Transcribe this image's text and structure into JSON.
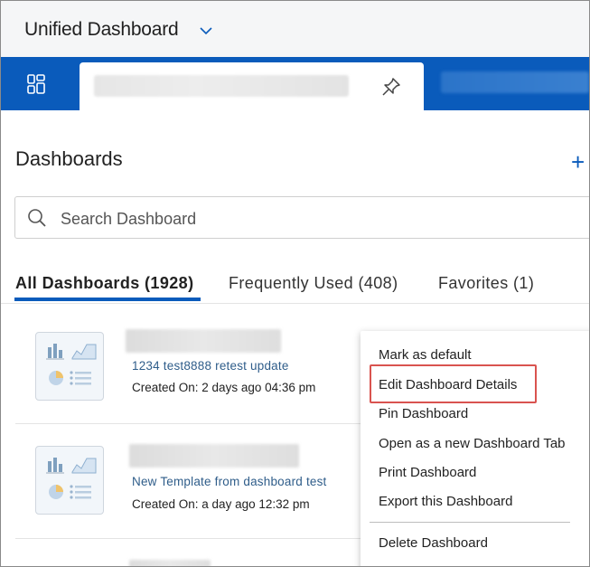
{
  "header": {
    "title": "Unified Dashboard"
  },
  "panel": {
    "title": "Dashboards",
    "add_label": "+",
    "search_placeholder": "Search Dashboard"
  },
  "tabs": [
    {
      "label": "All Dashboards (1928)"
    },
    {
      "label": "Frequently Used (408)"
    },
    {
      "label": "Favorites (1)"
    }
  ],
  "rows": [
    {
      "description": "1234 test8888 retest update",
      "created": "Created On: 2 days ago 04:36 pm"
    },
    {
      "description": "New Template from dashboard test",
      "created": "Created On: a day ago 12:32 pm"
    }
  ],
  "context_menu": {
    "items": [
      "Mark as default",
      "Edit Dashboard Details",
      "Pin Dashboard",
      "Open as a new Dashboard Tab",
      "Print Dashboard",
      "Export this Dashboard",
      "Delete Dashboard"
    ]
  },
  "colors": {
    "brand_blue": "#0a5bbb",
    "highlight_red": "#d9534f",
    "link_blue": "#2f5d8a"
  },
  "icons": [
    "chevron-down-icon",
    "layout-icon",
    "pin-icon",
    "search-icon",
    "chart-thumbnail-icon"
  ]
}
